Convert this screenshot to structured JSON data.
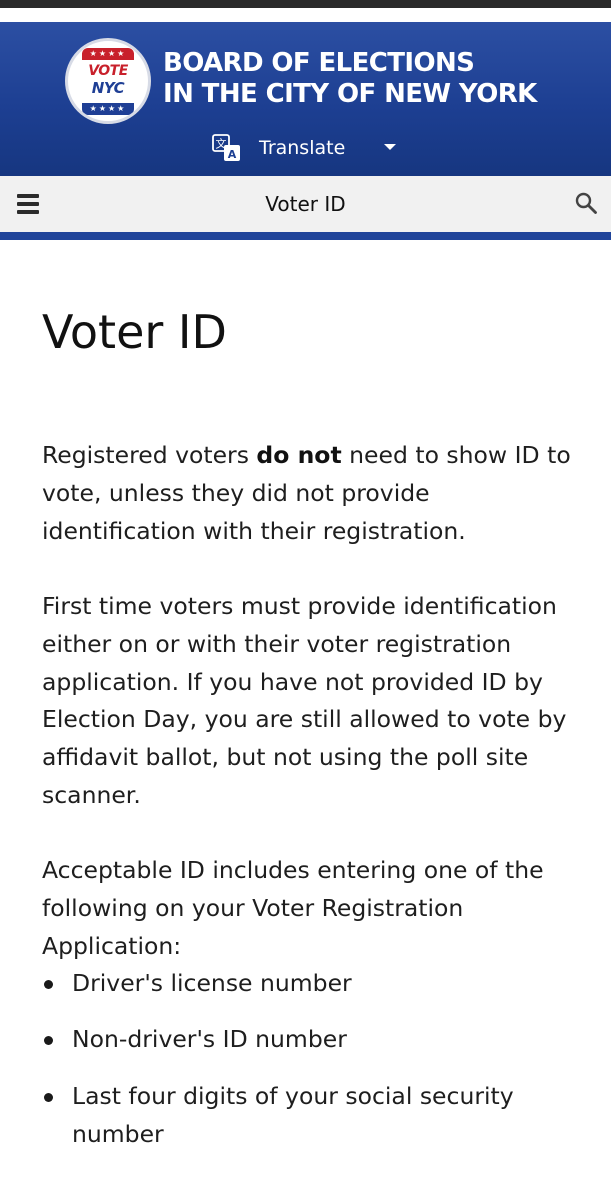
{
  "header": {
    "logo": {
      "line1": "VOTE",
      "line2": "NYC",
      "stars": "★★★★"
    },
    "org_line1": "BOARD OF ELECTIONS",
    "org_line2": "IN THE CITY OF NEW YORK",
    "translate_label": "Translate",
    "translate_icon": "translate-icon",
    "colors": {
      "header_blue": "#1d3f92",
      "accent_red": "#c8202b"
    }
  },
  "navbar": {
    "menu_icon": "hamburger-menu-icon",
    "title": "Voter ID",
    "search_icon": "search-icon"
  },
  "main": {
    "title": "Voter ID",
    "para1_pre": "Registered voters ",
    "para1_bold": "do not",
    "para1_post": " need to show ID to vote, unless they did not provide identification with their registration.",
    "para2": "First time voters must provide identification either on or with their voter registration application. If you have not provided ID by Election Day, you are still allowed to vote by affidavit ballot, but not using the poll site scanner.",
    "para3": "Acceptable ID includes entering one of the following on your Voter Registration Application:",
    "list": [
      "Driver's license number",
      "Non-driver's ID number",
      "Last four digits of your social security number"
    ]
  }
}
